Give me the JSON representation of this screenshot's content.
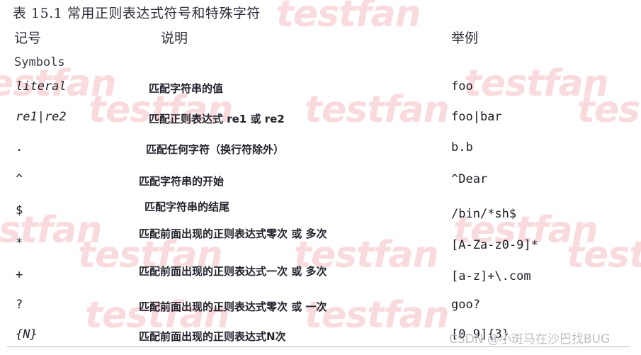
{
  "table": {
    "title": "表 15.1 常用正则表达式符号和特殊字符",
    "headers": {
      "notation": "记号",
      "description": "说明",
      "example": "举例"
    },
    "group_label": "Symbols",
    "rows": [
      {
        "symbol": "literal",
        "symbol_style": "italic",
        "description": "匹配字符串的值",
        "example": "foo"
      },
      {
        "symbol": "re1|re2",
        "symbol_style": "italic",
        "description": "匹配正则表达式 re1 或 re2",
        "example": "foo|bar"
      },
      {
        "symbol": ".",
        "symbol_style": "plain",
        "description": "匹配任何字符（换行符除外）",
        "example": "b.b"
      },
      {
        "symbol": "^",
        "symbol_style": "plain",
        "description": "匹配字符串的开始",
        "example": "^Dear"
      },
      {
        "symbol": "$",
        "symbol_style": "plain",
        "description": "匹配字符串的结尾",
        "example": "/bin/*sh$"
      },
      {
        "symbol": "*",
        "symbol_style": "plain",
        "description": "匹配前面出现的正则表达式零次 或 多次",
        "example": "[A-Za-z0-9]*"
      },
      {
        "symbol": "+",
        "symbol_style": "plain",
        "description": "匹配前面出现的正则表达式一次 或 多次",
        "example": "[a-z]+\\.com"
      },
      {
        "symbol": "?",
        "symbol_style": "plain",
        "description": "匹配前面出现的正则表达式零次 或 一次",
        "example": "goo?"
      },
      {
        "symbol": "{N}",
        "symbol_style": "italic",
        "description": "匹配前面出现的正则表达式N次",
        "example": "[0-9]{3}"
      }
    ]
  },
  "watermarks": {
    "tiled_text": "testfan",
    "tiled_color": "#fadbdd",
    "csdn": "CSDN @小斑马在沙巴找BUG",
    "csdn_color": "#bdbdc4"
  }
}
